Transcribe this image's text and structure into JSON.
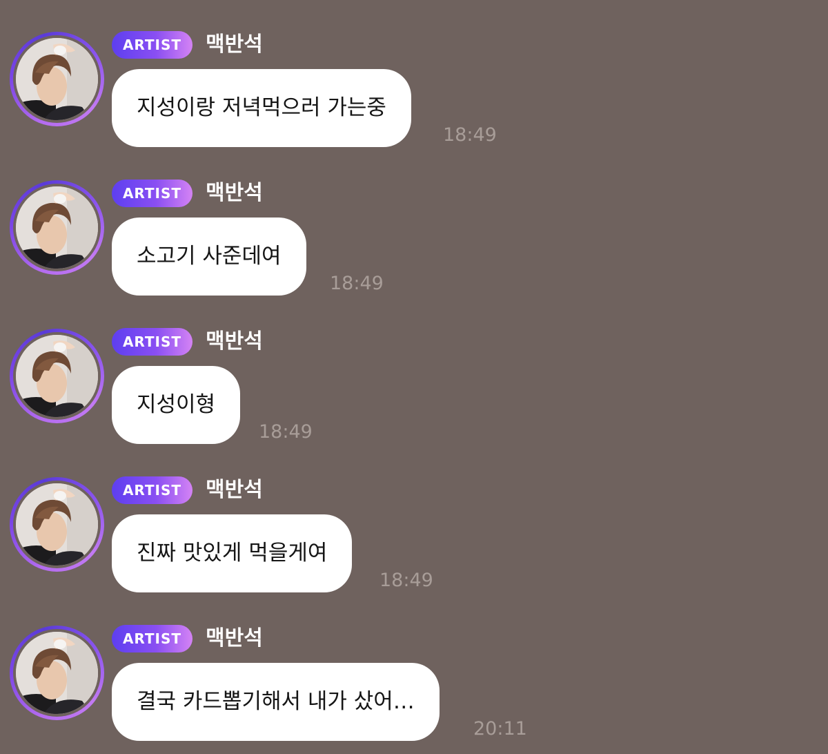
{
  "badge_label": "ARTIST",
  "messages": [
    {
      "sender": "맥반석",
      "text": "지성이랑 저녁먹으러 가는중",
      "time": "18:49"
    },
    {
      "sender": "맥반석",
      "text": "소고기 사준데여",
      "time": "18:49"
    },
    {
      "sender": "맥반석",
      "text": "지성이형",
      "time": "18:49"
    },
    {
      "sender": "맥반석",
      "text": "진짜 맛있게 먹을게여",
      "time": "18:49"
    },
    {
      "sender": "맥반석",
      "text": "결국 카드뽑기해서 내가 샀어…",
      "time": "20:11"
    }
  ],
  "colors": {
    "background": "#6f625e",
    "badge_gradient_start": "#5d3ff0",
    "badge_gradient_end": "#d483f4",
    "bubble": "#ffffff",
    "timestamp": "#a89d98"
  },
  "icons": {
    "avatar": "profile-photo"
  }
}
